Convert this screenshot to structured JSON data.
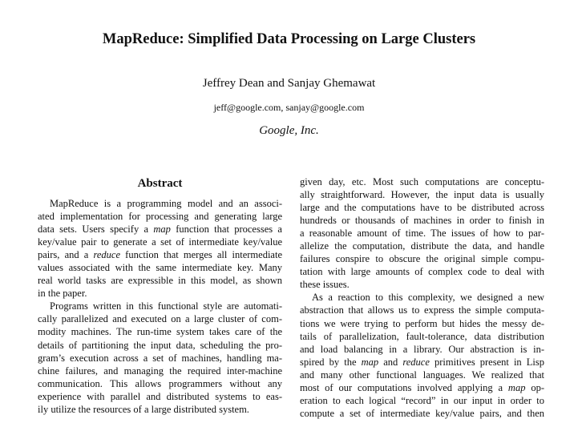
{
  "header": {
    "title": "MapReduce: Simplified Data Processing on Large Clusters",
    "authors": "Jeffrey Dean and Sanjay Ghemawat",
    "emails": "jeff@google.com, sanjay@google.com",
    "affiliation": "Google, Inc."
  },
  "abstract": {
    "heading": "Abstract",
    "left_column": [
      {
        "text": "MapReduce is a programming model and an associ-",
        "indent": true
      },
      {
        "text": "ated implementation for processing and generating large"
      },
      {
        "text": "data sets. Users specify a map function that processes a"
      },
      {
        "text": "key/value pair to generate a set of intermediate key/value"
      },
      {
        "text": "pairs, and a reduce function that merges all intermediate"
      },
      {
        "text": "values associated with the same intermediate key. Many"
      },
      {
        "text": "real world tasks are expressible in this model, as shown"
      },
      {
        "text": "in the paper.",
        "last": true
      },
      {
        "text": "Programs written in this functional style are automati-",
        "indent": true
      },
      {
        "text": "cally parallelized and executed on a large cluster of com-"
      },
      {
        "text": "modity machines. The run-time system takes care of the"
      },
      {
        "text": "details of partitioning the input data, scheduling the pro-"
      },
      {
        "text": "gram’s execution across a set of machines, handling ma-"
      },
      {
        "text": "chine failures, and managing the required inter-machine"
      },
      {
        "text": "communication. This allows programmers without any"
      },
      {
        "text": "experience with parallel and distributed systems to eas-"
      },
      {
        "text": "ily utilize the resources of a large distributed system.",
        "last": true
      }
    ],
    "right_column": [
      {
        "text": "given day, etc. Most such computations are conceptu-"
      },
      {
        "text": "ally straightforward. However, the input data is usually"
      },
      {
        "text": "large and the computations have to be distributed across"
      },
      {
        "text": "hundreds or thousands of machines in order to finish in"
      },
      {
        "text": "a reasonable amount of time. The issues of how to par-"
      },
      {
        "text": "allelize the computation, distribute the data, and handle"
      },
      {
        "text": "failures conspire to obscure the original simple compu-"
      },
      {
        "text": "tation with large amounts of complex code to deal with"
      },
      {
        "text": "these issues.",
        "last": true
      },
      {
        "text": "As a reaction to this complexity, we designed a new",
        "indent": true
      },
      {
        "text": "abstraction that allows us to express the simple computa-"
      },
      {
        "text": "tions we were trying to perform but hides the messy de-"
      },
      {
        "text": "tails of parallelization, fault-tolerance, data distribution"
      },
      {
        "text": "and load balancing in a library. Our abstraction is in-"
      },
      {
        "text": "spired by the map and reduce primitives present in Lisp"
      },
      {
        "text": "and many other functional languages. We realized that"
      },
      {
        "text": "most of our computations involved applying a map op-"
      },
      {
        "text": "eration to each logical “record” in our input in order to"
      },
      {
        "text": "compute a set of intermediate key/value pairs, and then"
      }
    ]
  }
}
